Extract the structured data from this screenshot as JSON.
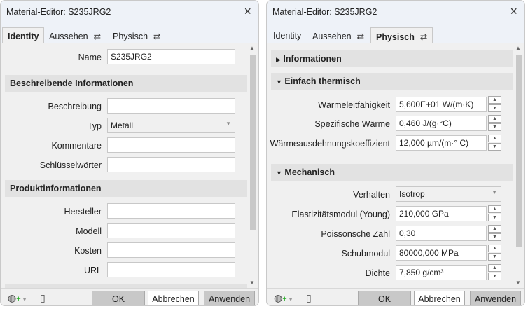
{
  "left": {
    "title": "Material-Editor: S235JRG2",
    "tabs": [
      "Identity",
      "Aussehen",
      "Physisch"
    ],
    "name_label": "Name",
    "name_value": "S235JRG2",
    "section1": "Beschreibende Informationen",
    "beschreibung": "Beschreibung",
    "typ": "Typ",
    "typ_value": "Metall",
    "kommentare": "Kommentare",
    "schluessel": "Schlüsselwörter",
    "section2": "Produktinformationen",
    "hersteller": "Hersteller",
    "modell": "Modell",
    "kosten": "Kosten",
    "url": "URL"
  },
  "right": {
    "title": "Material-Editor: S235JRG2",
    "tabs": [
      "Identity",
      "Aussehen",
      "Physisch"
    ],
    "sec_info": "Informationen",
    "sec_therm": "Einfach thermisch",
    "thermal": [
      {
        "label": "Wärmeleitfähigkeit",
        "value": "5,600E+01 W/(m·K)"
      },
      {
        "label": "Spezifische Wärme",
        "value": "0,460 J/(g·°C)"
      },
      {
        "label": "Wärmeausdehnungskoeffizient",
        "value": "12,000 µm/(m·° C)"
      }
    ],
    "sec_mech": "Mechanisch",
    "verhalten": "Verhalten",
    "verhalten_value": "Isotrop",
    "mech": [
      {
        "label": "Elastizitätsmodul (Young)",
        "value": "210,000 GPa"
      },
      {
        "label": "Poissonsche Zahl",
        "value": "0,30"
      },
      {
        "label": "Schubmodul",
        "value": "80000,000 MPa"
      },
      {
        "label": "Dichte",
        "value": "7,850 g/cm³"
      }
    ]
  },
  "footer": {
    "ok": "OK",
    "cancel": "Abbrechen",
    "apply": "Anwenden"
  },
  "icons": {
    "close": "×",
    "swap": "⇄",
    "collapsed": "▶",
    "expanded": "▼"
  }
}
